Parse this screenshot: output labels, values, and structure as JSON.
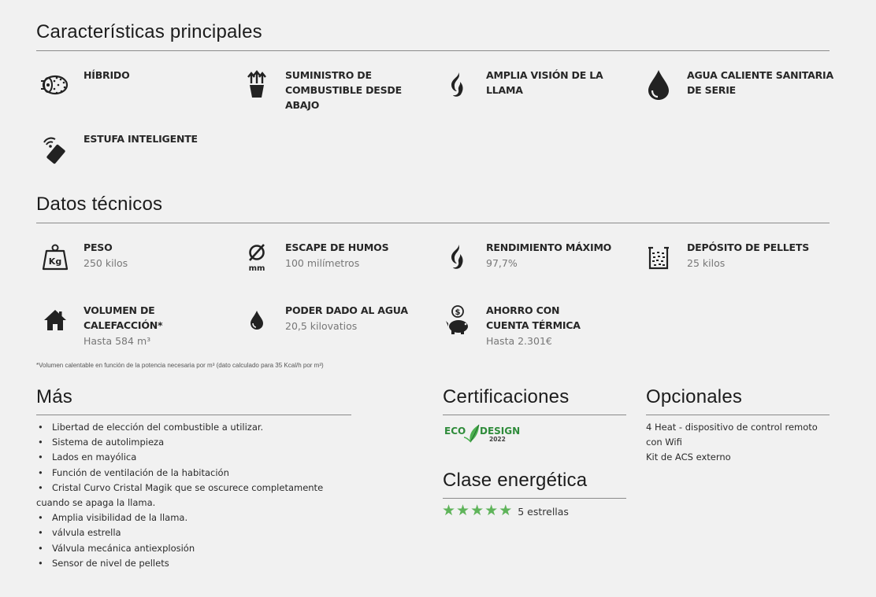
{
  "caracteristicas": {
    "title": "Características principales",
    "items": [
      {
        "label": "HÍBRIDO",
        "icon": "wood-pellet-hybrid-icon"
      },
      {
        "label": "SUMINISTRO DE COMBUSTIBLE DESDE ABAJO",
        "icon": "fuel-feed-from-below-icon"
      },
      {
        "label": "AMPLIA VISIÓN DE LA LLAMA",
        "icon": "flame-icon"
      },
      {
        "label": "AGUA CALIENTE SANITARIA DE SERIE",
        "icon": "water-drop-icon"
      },
      {
        "label": "ESTUFA INTELIGENTE",
        "icon": "smartphone-wifi-icon"
      }
    ]
  },
  "datos": {
    "title": "Datos técnicos",
    "items": [
      {
        "label": "PESO",
        "value": "250 kilos",
        "icon": "weight-kg-icon"
      },
      {
        "label": "ESCAPE DE HUMOS",
        "value": "100 milímetros",
        "icon": "diameter-mm-icon"
      },
      {
        "label": "RENDIMIENTO MÁXIMO",
        "value": "97,7%",
        "icon": "flame-icon"
      },
      {
        "label": "DEPÓSITO DE PELLETS",
        "value": "25 kilos",
        "icon": "pellet-tank-icon"
      },
      {
        "label": "VOLUMEN DE CALEFACCIÓN*",
        "value": "Hasta 584 m³",
        "icon": "house-icon"
      },
      {
        "label": "PODER DADO AL AGUA",
        "value": "20,5 kilovatios",
        "icon": "water-drop-icon"
      },
      {
        "label": "AHORRO CON CUENTA TÉRMICA",
        "value": "Hasta 2.301€",
        "icon": "piggy-bank-icon"
      }
    ],
    "footnote": "*Volumen calentable en función de la potencia necesaria por m³ (dato calculado para 35 Kcal/h por m³)"
  },
  "mas": {
    "title": "Más",
    "items": [
      "Libertad de elección del combustible a utilizar.",
      "Sistema de autolimpieza",
      "Lados en mayólica",
      "Función de ventilación de la habitación",
      "Cristal Curvo Cristal Magik que se oscurece completamente cuando se apaga la llama.",
      "Amplia visibilidad de la llama.",
      "válvula estrella",
      "Válvula mecánica antiexplosión",
      "Sensor de nivel de pellets"
    ]
  },
  "certificaciones": {
    "title": "Certificaciones",
    "badge": {
      "left": "ECO",
      "right": "DESIGN",
      "year": "2022",
      "icon": "leaf-icon"
    }
  },
  "clase": {
    "title": "Clase energética",
    "rating": 5,
    "rating_label": "5 estrellas"
  },
  "opcionales": {
    "title": "Opcionales",
    "lines": [
      "4 Heat - dispositivo de control remoto",
      "con Wifi",
      "Kit de ACS externo"
    ]
  },
  "colors": {
    "star": "#5fb45a",
    "eco_green": "#2e8b3a",
    "text": "#262626",
    "muted": "#777777"
  }
}
